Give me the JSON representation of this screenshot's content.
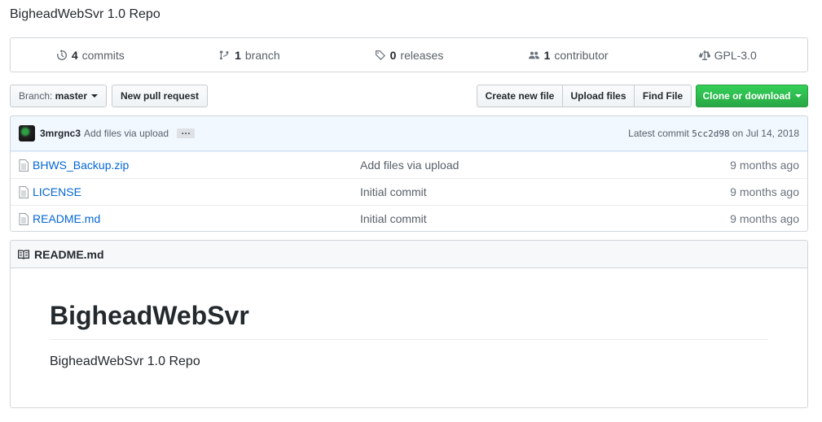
{
  "repo": {
    "description": "BigheadWebSvr 1.0 Repo"
  },
  "numbers": {
    "commits": {
      "count": "4",
      "label": "commits"
    },
    "branches": {
      "count": "1",
      "label": "branch"
    },
    "releases": {
      "count": "0",
      "label": "releases"
    },
    "contributors": {
      "count": "1",
      "label": "contributor"
    },
    "license": {
      "label": "GPL-3.0"
    }
  },
  "toolbar": {
    "branch_prefix": "Branch:",
    "branch_name": "master",
    "new_pr": "New pull request",
    "create_file": "Create new file",
    "upload_files": "Upload files",
    "find_file": "Find File",
    "clone": "Clone or download"
  },
  "commit": {
    "author": "3mrgnc3",
    "message": "Add files via upload",
    "ellipsis": "…",
    "latest_label": "Latest commit",
    "sha": "5cc2d98",
    "date": "on Jul 14, 2018"
  },
  "files": [
    {
      "name": "BHWS_Backup.zip",
      "message": "Add files via upload",
      "age": "9 months ago",
      "icon": "file-icon"
    },
    {
      "name": "LICENSE",
      "message": "Initial commit",
      "age": "9 months ago",
      "icon": "file-icon"
    },
    {
      "name": "README.md",
      "message": "Initial commit",
      "age": "9 months ago",
      "icon": "file-icon"
    }
  ],
  "readme": {
    "header": "README.md",
    "title": "BigheadWebSvr",
    "body": "BigheadWebSvr 1.0 Repo"
  },
  "colors": {
    "link": "#0366d6",
    "accent_green": "#28a745",
    "commit_bg": "#f1f8ff"
  }
}
